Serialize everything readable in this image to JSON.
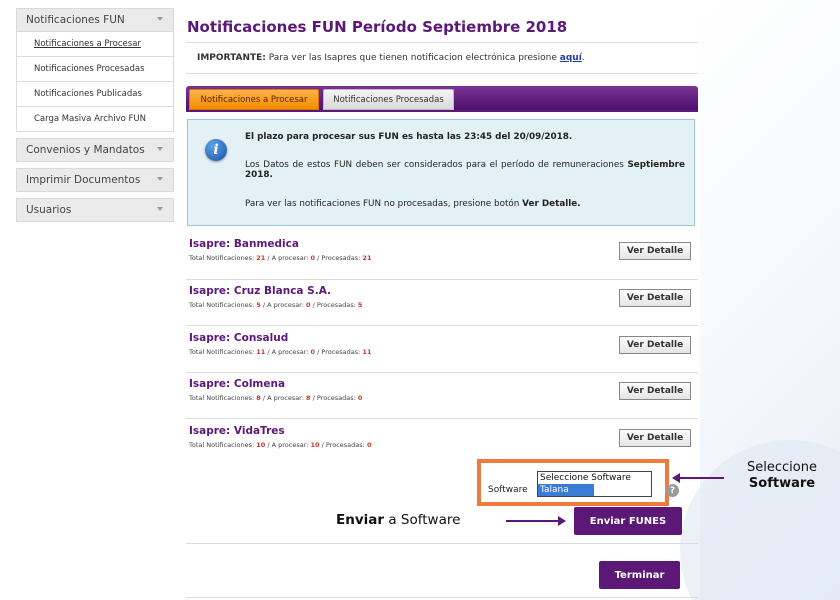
{
  "sidebar": {
    "groups": [
      {
        "label": "Notificaciones FUN",
        "items": [
          "Notificaciones a Procesar",
          "Notificaciones Procesadas",
          "Notificaciones Publicadas",
          "Carga Masiva Archivo FUN"
        ]
      },
      {
        "label": "Convenios y Mandatos"
      },
      {
        "label": "Imprimir Documentos"
      },
      {
        "label": "Usuarios"
      }
    ]
  },
  "page": {
    "title": "Notificaciones FUN Período Septiembre 2018",
    "important_label": "IMPORTANTE:",
    "important_text": "Para ver las Isapres que tienen notificacion electrónica presione",
    "important_link": "aquí",
    "important_end": "."
  },
  "tabs": [
    "Notificaciones a Procesar",
    "Notificaciones Procesadas"
  ],
  "info": {
    "line1": "El plazo para procesar sus FUN es hasta las 23:45 del 20/09/2018.",
    "line2_pre": "Los Datos de estos FUN deben ser considerados para el período de remuneraciones",
    "line2_bold": "Septiembre 2018.",
    "line3_pre": "Para ver las notificaciones FUN no procesadas, presione botón",
    "line3_bold": "Ver Detalle."
  },
  "stats_labels": {
    "total": "Total Notificaciones:",
    "pending": "/ A procesar:",
    "done": "/ Procesadas:"
  },
  "isapres": [
    {
      "name": "Isapre: Banmedica",
      "total": "21",
      "pending": "0",
      "done": "21"
    },
    {
      "name": "Isapre: Cruz Blanca S.A.",
      "total": "5",
      "pending": "0",
      "done": "5"
    },
    {
      "name": "Isapre: Consalud",
      "total": "11",
      "pending": "0",
      "done": "11"
    },
    {
      "name": "Isapre: Colmena",
      "total": "8",
      "pending": "8",
      "done": "0"
    },
    {
      "name": "Isapre: VidaTres",
      "total": "10",
      "pending": "10",
      "done": "0"
    }
  ],
  "detail_button": "Ver Detalle",
  "software": {
    "label": "Software",
    "options": [
      "Seleccione Software",
      "Talana"
    ],
    "selected": "Talana",
    "help": "?"
  },
  "annotations": {
    "select_line1": "Seleccione",
    "select_line2": "Software",
    "send_bold": "Enviar",
    "send_rest": "a Software"
  },
  "buttons": {
    "send": "Enviar FUNES",
    "finish": "Terminar"
  },
  "colors": {
    "brand_purple": "#5b1877",
    "tab_active": "#f28c00",
    "highlight_border": "#ee7b3b",
    "info_bg": "#e3f1f6",
    "stat_number": "#c0392b"
  }
}
